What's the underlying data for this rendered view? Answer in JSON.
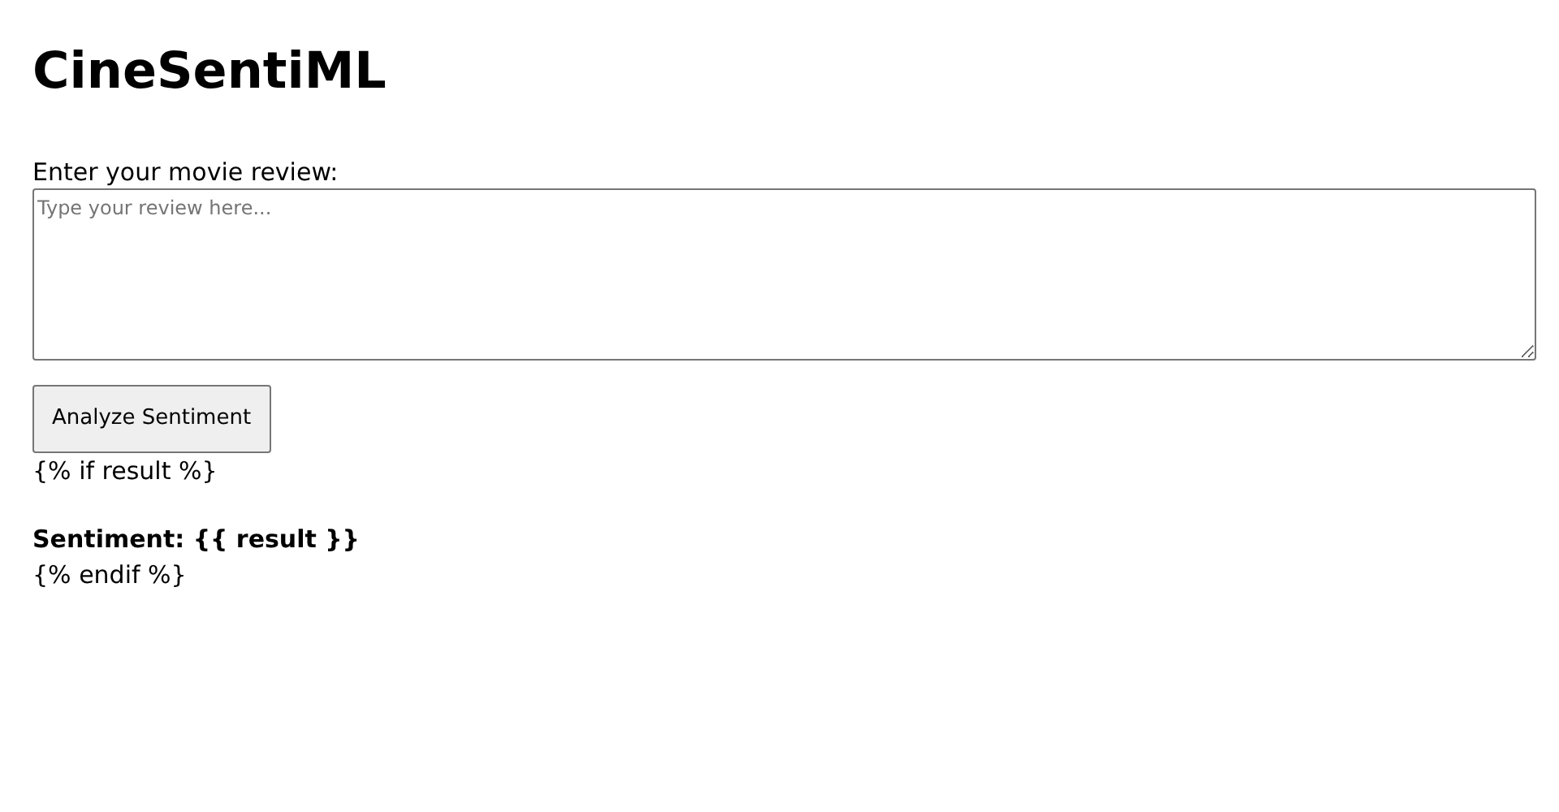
{
  "title": "CineSentiML",
  "review": {
    "label": "Enter your movie review:",
    "placeholder": "Type your review here..."
  },
  "button": "Analyze Sentiment",
  "lines": [
    {
      "kind": "plain",
      "text": "{% if result %}"
    },
    {
      "kind": "bold",
      "text": "Sentiment: {{ result }}"
    },
    {
      "kind": "plain",
      "text": "{% endif %}"
    }
  ]
}
